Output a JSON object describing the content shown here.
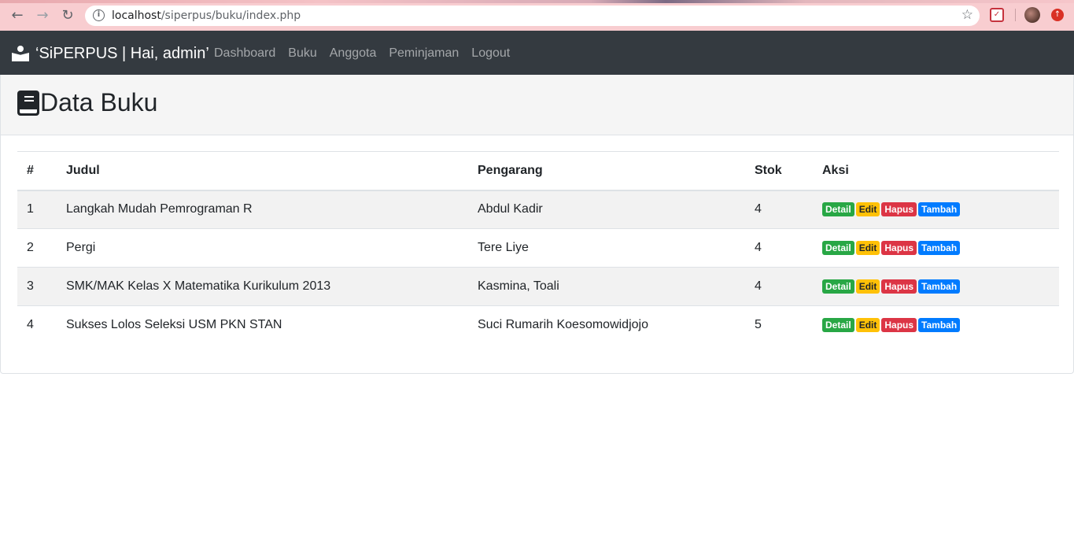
{
  "browser": {
    "url_host": "localhost",
    "url_path": "/siperpus/buku/index.php"
  },
  "navbar": {
    "brand": "‘SiPERPUS | Hai, admin’",
    "links": [
      "Dashboard",
      "Buku",
      "Anggota",
      "Peminjaman",
      "Logout"
    ]
  },
  "page": {
    "title": "Data Buku"
  },
  "table": {
    "headers": [
      "#",
      "Judul",
      "Pengarang",
      "Stok",
      "Aksi"
    ],
    "rows": [
      {
        "no": "1",
        "judul": "Langkah Mudah Pemrograman R",
        "pengarang": "Abdul Kadir",
        "stok": "4"
      },
      {
        "no": "2",
        "judul": "Pergi",
        "pengarang": "Tere Liye",
        "stok": "4"
      },
      {
        "no": "3",
        "judul": "SMK/MAK Kelas X Matematika Kurikulum 2013",
        "pengarang": "Kasmina, Toali",
        "stok": "4"
      },
      {
        "no": "4",
        "judul": "Sukses Lolos Seleksi USM PKN STAN",
        "pengarang": "Suci Rumarih Koesomowidjojo",
        "stok": "5"
      }
    ],
    "actions": {
      "detail": "Detail",
      "edit": "Edit",
      "hapus": "Hapus",
      "tambah": "Tambah"
    }
  },
  "colors": {
    "navbar_bg": "#343a40",
    "detail": "#28a745",
    "edit": "#ffc107",
    "hapus": "#dc3545",
    "tambah": "#007bff"
  }
}
